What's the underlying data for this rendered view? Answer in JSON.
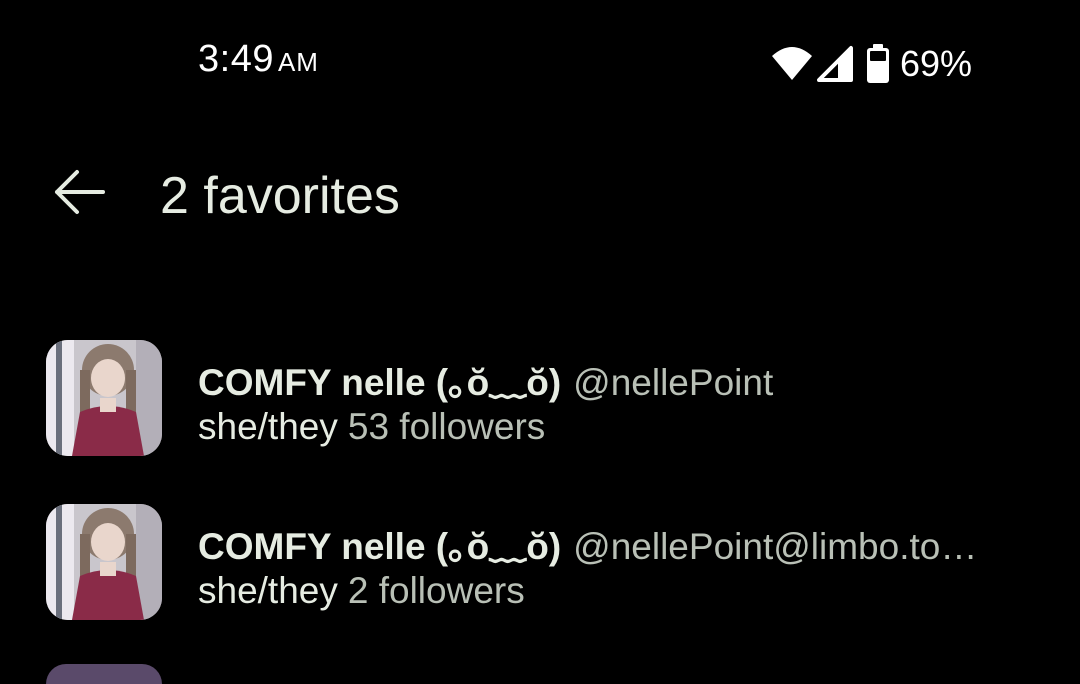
{
  "status_bar": {
    "time": "3:49",
    "ampm": "AM",
    "battery_percent": "69%",
    "icons": [
      "wifi-icon",
      "signal-icon",
      "battery-icon"
    ]
  },
  "app_bar": {
    "title": "2 favorites",
    "back_icon": "arrow-left-icon"
  },
  "favorites": [
    {
      "display_name": "COMFY nelle (｡ŏ﹏ŏ)",
      "handle": "@nellePoint",
      "pronouns": "she/they",
      "followers": "53 followers"
    },
    {
      "display_name": "COMFY nelle (｡ŏ﹏ŏ)",
      "handle": "@nellePoint@limbo.to…",
      "pronouns": "she/they",
      "followers": "2 followers"
    }
  ],
  "colors": {
    "background": "#000000",
    "primary_text": "#e6ece2",
    "secondary_text": "#b9c0b6"
  }
}
